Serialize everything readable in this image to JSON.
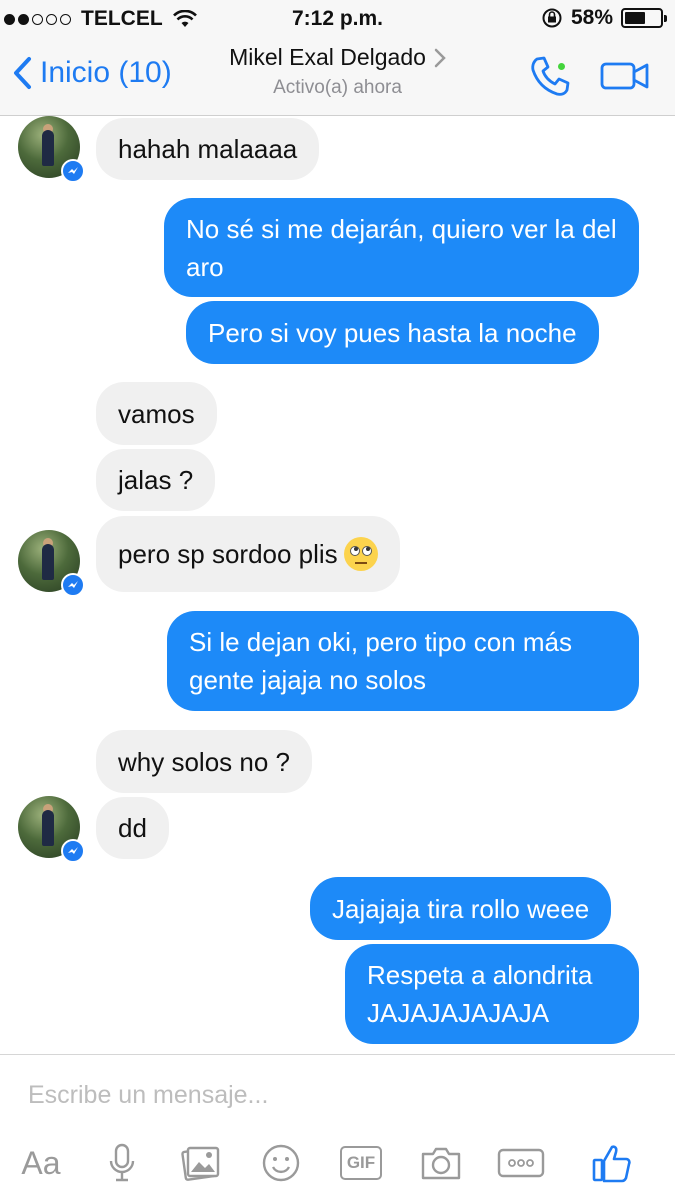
{
  "status_bar": {
    "carrier": "TELCEL",
    "time": "7:12 p.m.",
    "battery_percent": "58%",
    "battery_level": 0.58,
    "signal_bars": 2
  },
  "header": {
    "back_label": "Inicio (10)",
    "contact_name": "Mikel Exal Delgado",
    "contact_status": "Activo(a) ahora",
    "accent_color": "#1e7bf2",
    "online_color": "#44d43c"
  },
  "messages": [
    {
      "direction": "in",
      "text": "hahah malaaaa"
    },
    {
      "direction": "out",
      "text": "No sé si me dejarán, quiero ver la del aro"
    },
    {
      "direction": "out",
      "text": "Pero si voy pues hasta la noche"
    },
    {
      "direction": "in",
      "text": "vamos"
    },
    {
      "direction": "in",
      "text": "jalas ?"
    },
    {
      "direction": "in",
      "text": "pero sp sordoo plis",
      "emoji": "face-with-rolling-eyes"
    },
    {
      "direction": "out",
      "text": "Si le dejan oki, pero tipo con más gente jajaja no solos"
    },
    {
      "direction": "in",
      "text": "why solos no ?"
    },
    {
      "direction": "in",
      "text": "dd"
    },
    {
      "direction": "out",
      "text": "Jajajaja tira rollo weee"
    },
    {
      "direction": "out",
      "text": "Respeta a alondrita JAJAJAJAJAJA"
    }
  ],
  "composer": {
    "placeholder": "Escribe un mensaje...",
    "tools": [
      "Aa",
      "microphone-icon",
      "photo-gallery-icon",
      "emoji-icon",
      "GIF",
      "camera-icon",
      "more-icon",
      "like-icon"
    ]
  }
}
